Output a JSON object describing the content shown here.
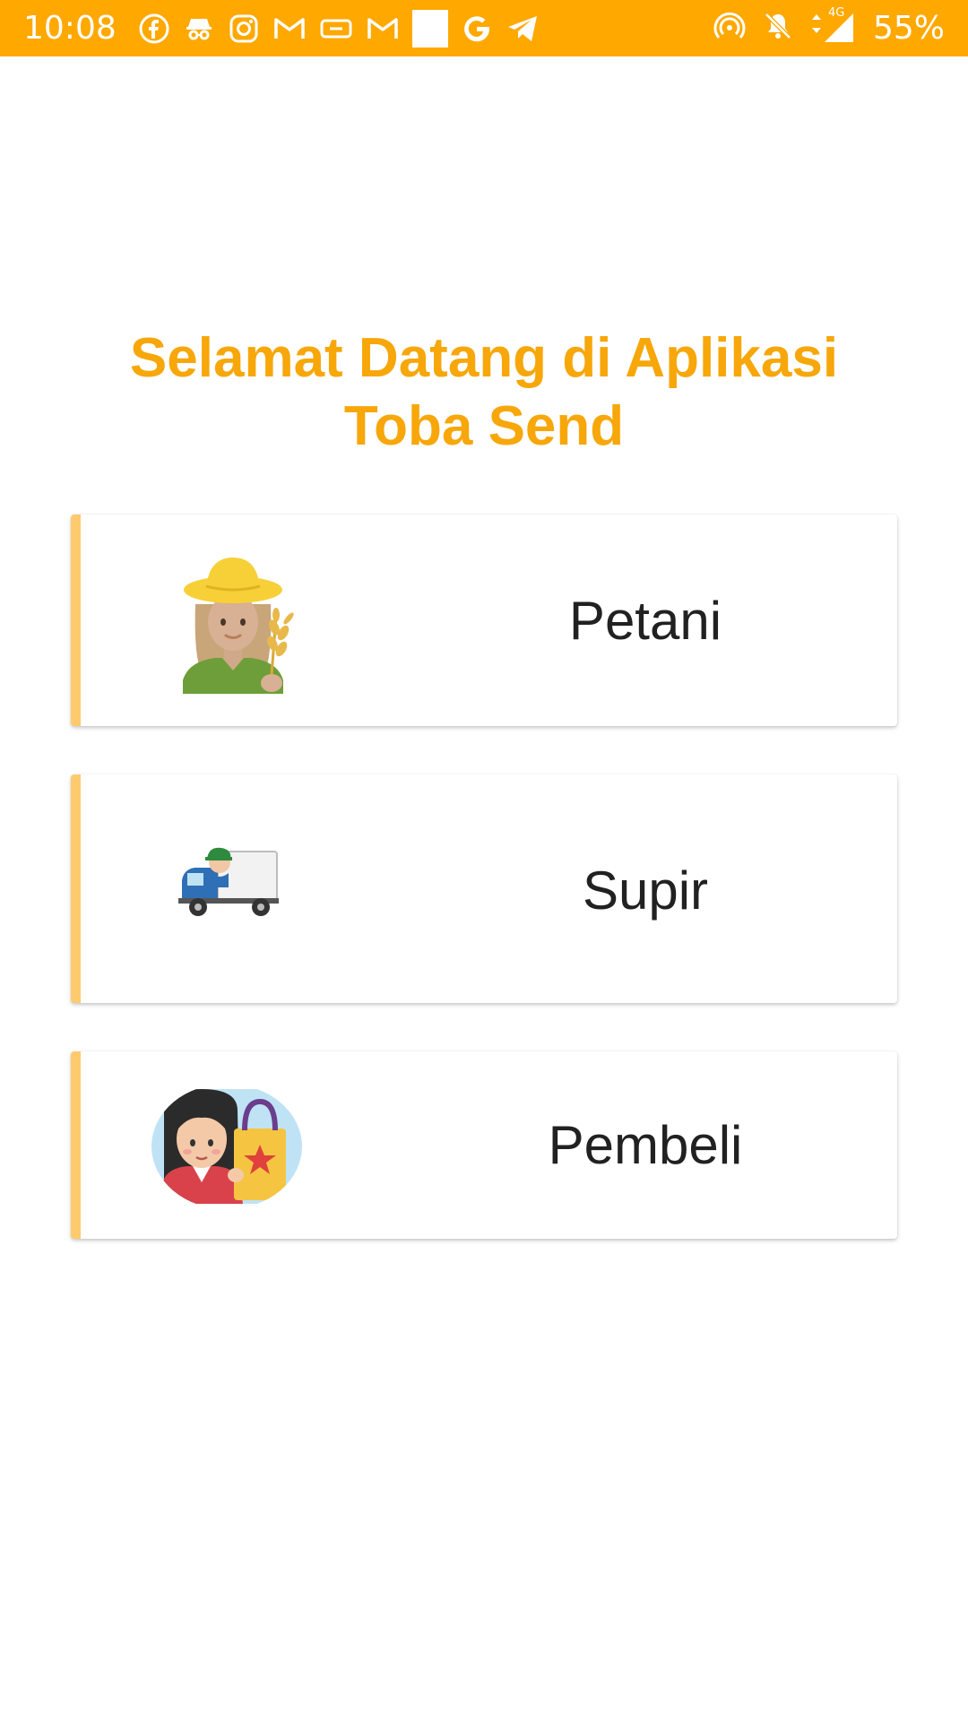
{
  "status_bar": {
    "time": "10:08",
    "battery": "55%",
    "network": "4G",
    "notification_icons": [
      "facebook-icon",
      "incognito-icon",
      "instagram-icon",
      "gmail-icon",
      "voicemail-icon",
      "gmail-icon",
      "blank-square-icon",
      "google-icon",
      "telegram-icon"
    ],
    "system_icons": [
      "hotspot-icon",
      "mute-bell-icon",
      "signal-icon"
    ],
    "background_color": "#FFA800"
  },
  "welcome": {
    "line1": "Selamat Datang di Aplikasi",
    "line2": "Toba Send",
    "color": "#F7A70A"
  },
  "roles": [
    {
      "label": "Petani",
      "icon": "farmer-icon"
    },
    {
      "label": "Supir",
      "icon": "delivery-truck-driver-icon"
    },
    {
      "label": "Pembeli",
      "icon": "shopper-icon"
    }
  ],
  "accent_color": "#FDCB6E"
}
